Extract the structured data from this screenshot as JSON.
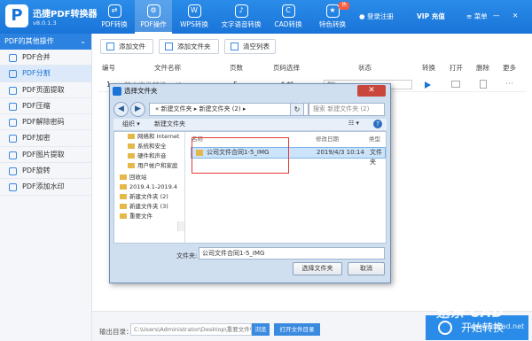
{
  "app": {
    "name": "迅捷PDF转换器",
    "version": "v8.0.1.3",
    "logo_letter": "P"
  },
  "nav": [
    {
      "label": "PDF转换",
      "icon": "convert-icon"
    },
    {
      "label": "PDF操作",
      "icon": "gear-icon",
      "active": true
    },
    {
      "label": "WPS转换",
      "icon": "w-icon"
    },
    {
      "label": "文字语音转换",
      "icon": "speech-icon"
    },
    {
      "label": "CAD转换",
      "icon": "cad-icon"
    },
    {
      "label": "特色转换",
      "icon": "star-icon",
      "badge": "热"
    }
  ],
  "account": {
    "login": "登录注册",
    "vip": "VIP 充值",
    "menu": "菜单"
  },
  "sidebar": {
    "header": "PDF的其他操作",
    "items": [
      {
        "label": "PDF合并"
      },
      {
        "label": "PDF分割",
        "active": true
      },
      {
        "label": "PDF页面提取"
      },
      {
        "label": "PDF压缩"
      },
      {
        "label": "PDF解除密码"
      },
      {
        "label": "PDF加密"
      },
      {
        "label": "PDF图片提取"
      },
      {
        "label": "PDF旋转"
      },
      {
        "label": "PDF添加水印"
      }
    ]
  },
  "toolbar": {
    "add_file": "添加文件",
    "add_folder": "添加文件夹",
    "clear_list": "清空列表"
  },
  "table": {
    "headers": [
      "编号",
      "文件名称",
      "页数",
      "页码选择",
      "状态",
      "转换",
      "打开",
      "删除",
      "更多"
    ],
    "row": {
      "num": "1",
      "name": "某本文件转换.pdf",
      "pages": "5",
      "range": "全部",
      "status": "0%"
    }
  },
  "output": {
    "label": "输出目录：",
    "path": "C:\\Users\\Administrator\\Desktop\\重要文件\\",
    "browse": "浏览",
    "open_dir": "打开文件目录",
    "start": "开始转换"
  },
  "watermark": {
    "main": "迅东 CAD",
    "sub": "www.xdcad.net"
  },
  "dialog": {
    "title": "选择文件夹",
    "breadcrumb": "« 新建文件夹 ▸ 新建文件夹 (2) ▸",
    "search_placeholder": "搜索 新建文件夹 (2)",
    "organize": "组织 ▾",
    "new_folder": "新建文件夹",
    "tree": [
      "网络和 Internet",
      "系统和安全",
      "硬件和声音",
      "用户帐户和家庭",
      "回收站",
      "2019.4.1-2019.4",
      "新建文件夹 (2)",
      "新建文件夹 (3)",
      "重要文件"
    ],
    "columns": {
      "name": "名称",
      "modified": "修改日期",
      "type": "类型"
    },
    "file": {
      "name": "公司文件合同1-5_IMG",
      "modified": "2019/4/3 10:14",
      "type": "文件夹"
    },
    "folder_label": "文件夹:",
    "folder_value": "公司文件合同1-5_IMG",
    "select_button": "选择文件夹",
    "cancel_button": "取消"
  }
}
